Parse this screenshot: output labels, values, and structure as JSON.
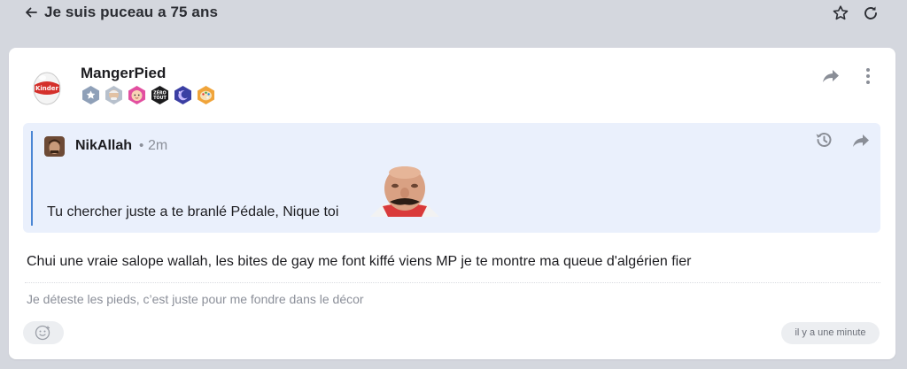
{
  "topbar": {
    "title": "Je suis puceau a 75 ans",
    "icons": [
      "back-arrow-icon",
      "star-icon",
      "refresh-icon"
    ]
  },
  "post": {
    "author": "MangerPied",
    "badges": [
      "star-badge",
      "old-man-badge",
      "baby-badge",
      "zero-tout-badge",
      "moon-badge",
      "palette-badge"
    ],
    "zero_tout_badge_text": "ZÉRO TOUT",
    "quote": {
      "author": "NikAllah",
      "separator": "•",
      "time": "2m",
      "text": "Tu chercher juste a te branlé Pédale, Nique toi"
    },
    "message": "Chui une vraie salope wallah, les bites de gay me font kiffé viens MP je te montre ma queue d'algérien fier",
    "signature": "Je déteste les pieds, c’est juste pour me fondre dans le décor",
    "timestamp": "il y a une minute"
  },
  "colors": {
    "page_background": "#d4d7de",
    "card_background": "#ffffff",
    "quote_background": "#eaf0fc",
    "quote_accent": "#4a86d4",
    "muted_text": "#8b8f99"
  }
}
